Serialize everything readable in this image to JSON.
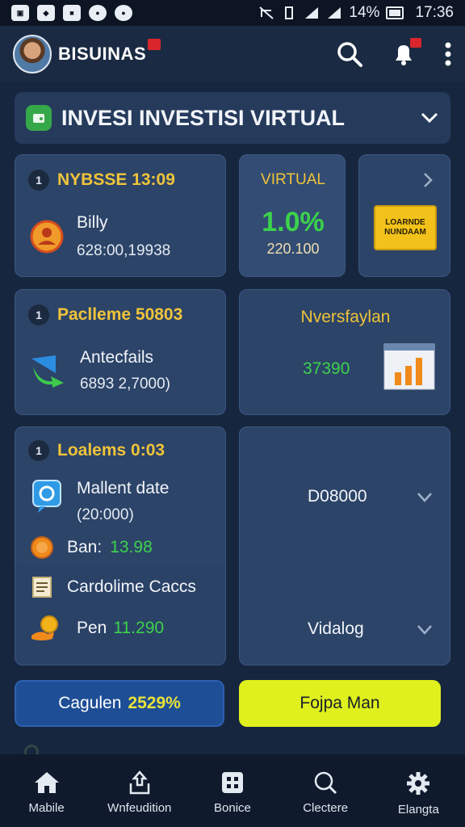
{
  "status_bar": {
    "left_icons": [
      "messenger-icon",
      "app-icon",
      "app-icon",
      "whatsapp-icon",
      "whatsapp-icon"
    ],
    "battery": "14%",
    "time": "17:36"
  },
  "app_bar": {
    "brand": "BISUINAS"
  },
  "selector": {
    "title": "INVESI INVESTISI VIRTUAL"
  },
  "card_1": {
    "index": "1",
    "header": "NYBSSE 13:09",
    "name": "Billy",
    "value": "628:00,19938"
  },
  "card_virtual": {
    "label": "VIRTUAL",
    "percent": "1.0%",
    "amount": "220.100"
  },
  "card_side": {
    "button_label": "LOARNDE NUNDAAM"
  },
  "card_2": {
    "index": "1",
    "header": "Paclleme 50803",
    "name": "Antecfails",
    "value": "6893 2,7000)"
  },
  "card_invest": {
    "label": "Nversfaylan",
    "value": "37390"
  },
  "card_3": {
    "index": "1",
    "header": "Loalems 0:03",
    "item1_label": "Mallent date",
    "item1_value": "(20:000)",
    "item2_label": "Ban:",
    "item2_value": "13.98",
    "item3_label": "Cardolime Caccs",
    "item4_label": "Pen",
    "item4_value": "11.290"
  },
  "card_right": {
    "item1": "D08000",
    "item2": "Vidalog"
  },
  "buttons": {
    "blue_label": "Cagulen",
    "blue_value": "2529%",
    "yellow_label": "Fojpa Man"
  },
  "bottom_nav": [
    {
      "label": "Mabile",
      "icon": "home-icon"
    },
    {
      "label": "Wnfeudition",
      "icon": "share-icon"
    },
    {
      "label": "Bonice",
      "icon": "grid-icon"
    },
    {
      "label": "Clectere",
      "icon": "search-icon"
    },
    {
      "label": "Elangta",
      "icon": "gear-icon"
    }
  ],
  "colors": {
    "background": "#17263f",
    "card": "#2c4468",
    "accent_yellow": "#f0c43a",
    "accent_green": "#3cd24b",
    "button_blue": "#1e4e96",
    "button_yellow": "#e0f01c"
  }
}
